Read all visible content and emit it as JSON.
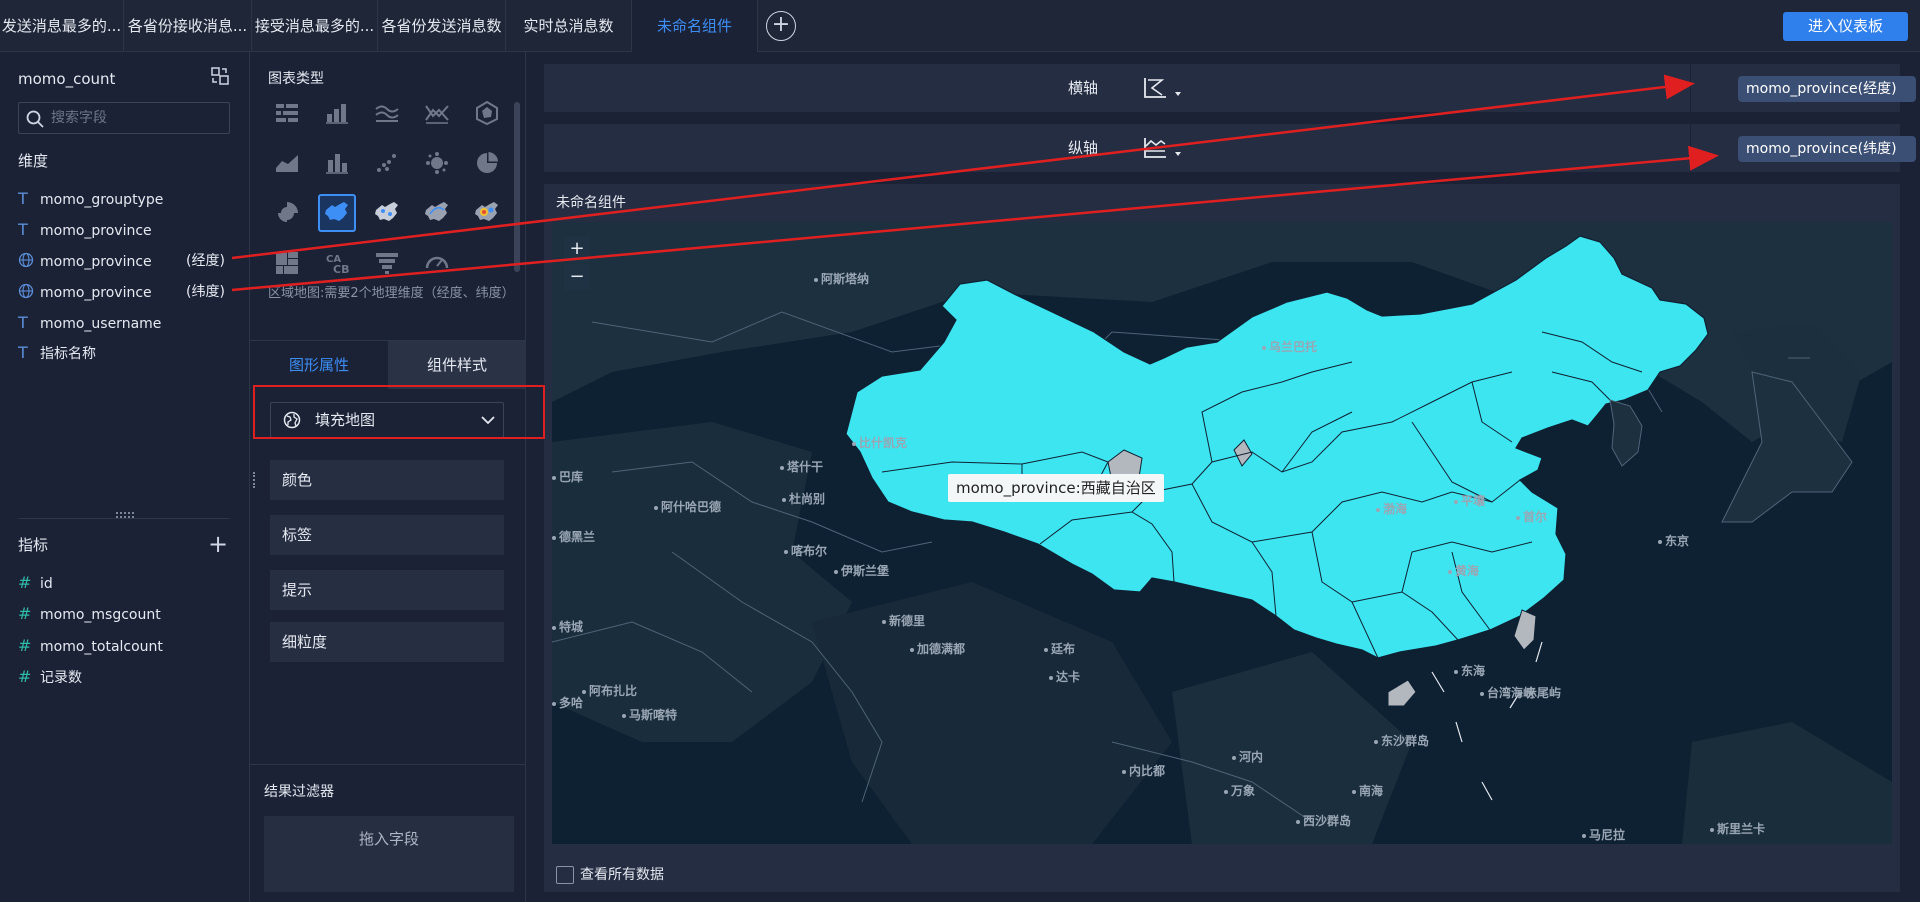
{
  "tabs": [
    {
      "label": "发送消息最多的...",
      "active": false
    },
    {
      "label": "各省份接收消息...",
      "active": false
    },
    {
      "label": "接受消息最多的...",
      "active": false
    },
    {
      "label": "各省份发送消息数",
      "active": false
    },
    {
      "label": "实时总消息数",
      "active": false
    },
    {
      "label": "未命名组件",
      "active": true
    }
  ],
  "header": {
    "enter_dashboard": "进入仪表板"
  },
  "fields_panel": {
    "dataset": "momo_count",
    "search_placeholder": "搜索字段",
    "dimensions_title": "维度",
    "dimensions": [
      {
        "name": "momo_grouptype",
        "icon": "text-type-icon"
      },
      {
        "name": "momo_province",
        "icon": "text-type-icon"
      },
      {
        "name": "momo_province",
        "suffix": "(经度)",
        "icon": "globe-icon"
      },
      {
        "name": "momo_province",
        "suffix": "(纬度)",
        "icon": "globe-icon"
      },
      {
        "name": "momo_username",
        "icon": "text-type-icon"
      },
      {
        "name": "指标名称",
        "icon": "text-type-icon"
      }
    ],
    "measures_title": "指标",
    "measures": [
      {
        "name": "id",
        "icon": "hash-icon"
      },
      {
        "name": "momo_msgcount",
        "icon": "hash-icon"
      },
      {
        "name": "momo_totalcount",
        "icon": "hash-icon"
      },
      {
        "name": "记录数",
        "icon": "hash-icon"
      }
    ]
  },
  "config_panel": {
    "chart_type_title": "图表类型",
    "chart_hint": "区域地图:需要2个地理维度（经度、纬度）",
    "tabs": {
      "graph_props": "图形属性",
      "component_style": "组件样式"
    },
    "map_type": "填充地图",
    "props": [
      "颜色",
      "标签",
      "提示",
      "细粒度"
    ],
    "filter_title": "结果过滤器",
    "drop_field": "拖入字段"
  },
  "axes": {
    "x_label": "横轴",
    "y_label": "纵轴",
    "x_field": "momo_province(经度)",
    "y_field": "momo_province(纬度)"
  },
  "chart": {
    "title": "未命名组件",
    "zoom_in": "+",
    "zoom_out": "−",
    "tooltip_key": "momo_province",
    "tooltip_value": "西藏自治区",
    "view_all": "查看所有数据",
    "fill_color": "#3de5f0",
    "map_labels": [
      "阿斯塔纳",
      "乌兰巴托",
      "比什凯克",
      "塔什干",
      "杜尚别",
      "阿什哈巴德",
      "喀布尔",
      "伊斯兰堡",
      "德黑兰",
      "巴库",
      "新德里",
      "加德满都",
      "廷布",
      "达卡",
      "内比都",
      "河内",
      "万象",
      "马尼拉",
      "平壤",
      "首尔",
      "东京",
      "黄海",
      "渤海",
      "东海",
      "台湾海峡",
      "东沙群岛",
      "南海",
      "赤尾屿",
      "马斯喀特",
      "阿布扎比",
      "多哈",
      "特城",
      "斯里兰卡",
      "西沙群岛"
    ]
  },
  "colors": {
    "accent": "#3d8ef5",
    "annotation": "#e02020"
  }
}
